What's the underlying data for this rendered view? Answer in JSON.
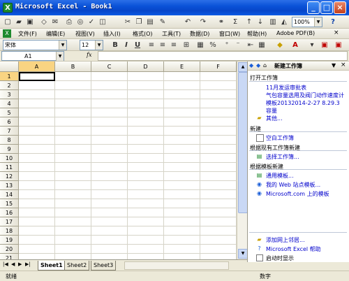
{
  "window": {
    "title": "Microsoft Excel - Book1"
  },
  "menu": [
    "文件(F)",
    "编辑(E)",
    "视图(V)",
    "插入(I)",
    "格式(O)",
    "工具(T)",
    "数据(D)",
    "窗口(W)",
    "帮助(H)",
    "Adobe PDF(B)"
  ],
  "toolbar": {
    "zoom": "100%",
    "help": "?"
  },
  "format": {
    "font_name": "宋体",
    "font_size": "12",
    "bold": "B",
    "italic": "I",
    "underline": "U",
    "percent": "%"
  },
  "formula_bar": {
    "name_box": "A1",
    "fx": "fx"
  },
  "grid": {
    "columns": [
      "A",
      "B",
      "C",
      "D",
      "E",
      "F"
    ],
    "rows": [
      "1",
      "2",
      "3",
      "4",
      "5",
      "6",
      "7",
      "8",
      "9",
      "10",
      "11",
      "12",
      "13",
      "14",
      "15",
      "16",
      "17",
      "18",
      "19",
      "20",
      "21"
    ],
    "selected_cell": "A1"
  },
  "taskpane": {
    "title": "新建工作簿",
    "open_head": "打开工作簿",
    "recent": [
      "11月发运审批表",
      "气包容量选用及阀门动作速度计",
      "模板20132014-2-27 8.29.3",
      "容量"
    ],
    "more": "其他...",
    "new_head": "新建",
    "blank": "空白工作簿",
    "from_existing_head": "根据现有工作簿新建",
    "choose": "选择工作簿...",
    "from_template_head": "根据模板新建",
    "templates": [
      "通用模板...",
      "我的 Web 站点模板...",
      "Microsoft.com 上的模板"
    ],
    "bottom": [
      "添加网上邻居...",
      "Microsoft Excel 帮助",
      "启动时显示"
    ]
  },
  "sheets": [
    "Sheet1",
    "Sheet2",
    "Sheet3"
  ],
  "status": {
    "left": "就绪",
    "right": "数字"
  }
}
